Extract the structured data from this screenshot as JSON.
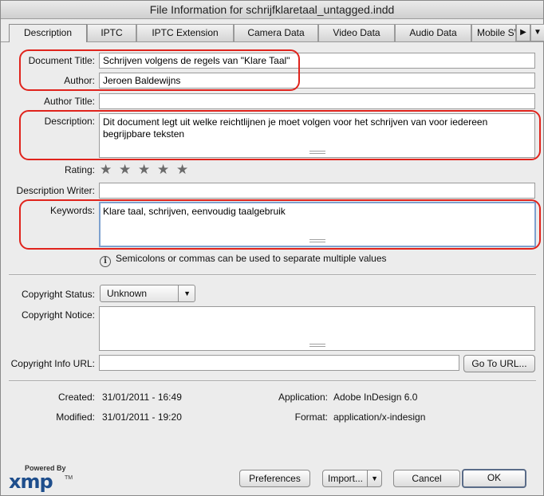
{
  "window": {
    "title": "File Information for schrijfklaretaal_untagged.indd"
  },
  "tabs": [
    {
      "label": "Description",
      "active": true
    },
    {
      "label": "IPTC"
    },
    {
      "label": "IPTC Extension"
    },
    {
      "label": "Camera Data"
    },
    {
      "label": "Video Data"
    },
    {
      "label": "Audio Data"
    },
    {
      "label": "Mobile SWF"
    }
  ],
  "tab_controls": {
    "next_icon": "triangle-right-icon",
    "menu_icon": "triangle-down-icon"
  },
  "form": {
    "document_title": {
      "label": "Document Title:",
      "value": "Schrijven volgens de regels van \"Klare Taal\""
    },
    "author": {
      "label": "Author:",
      "value": "Jeroen Baldewijns"
    },
    "author_title": {
      "label": "Author Title:",
      "value": ""
    },
    "description": {
      "label": "Description:",
      "value": "Dit document legt uit welke reichtlijnen je moet volgen voor het schrijven van voor iedereen begrijpbare teksten"
    },
    "rating": {
      "label": "Rating:",
      "stars": 0,
      "max": 5
    },
    "description_writer": {
      "label": "Description Writer:",
      "value": ""
    },
    "keywords": {
      "label": "Keywords:",
      "value": "Klare taal, schrijven, eenvoudig taalgebruik"
    },
    "keywords_hint": "Semicolons or commas can be used to separate multiple values",
    "copyright_status": {
      "label": "Copyright Status:",
      "value": "Unknown"
    },
    "copyright_notice": {
      "label": "Copyright Notice:",
      "value": ""
    },
    "copyright_info_url": {
      "label": "Copyright Info URL:",
      "value": "",
      "button": "Go To URL..."
    }
  },
  "meta": {
    "created_label": "Created:",
    "created": "31/01/2011 - 16:49",
    "modified_label": "Modified:",
    "modified": "31/01/2011 - 19:20",
    "application_label": "Application:",
    "application": "Adobe InDesign 6.0",
    "format_label": "Format:",
    "format": "application/x-indesign"
  },
  "logo": {
    "powered_by": "Powered By",
    "text": "xmp",
    "tm": "TM"
  },
  "buttons": {
    "preferences": "Preferences",
    "import": "Import...",
    "cancel": "Cancel",
    "ok": "OK"
  },
  "colors": {
    "highlight": "#e0231c",
    "focus": "#7ea1cf",
    "xmp_brand": "#1e4e8c"
  }
}
